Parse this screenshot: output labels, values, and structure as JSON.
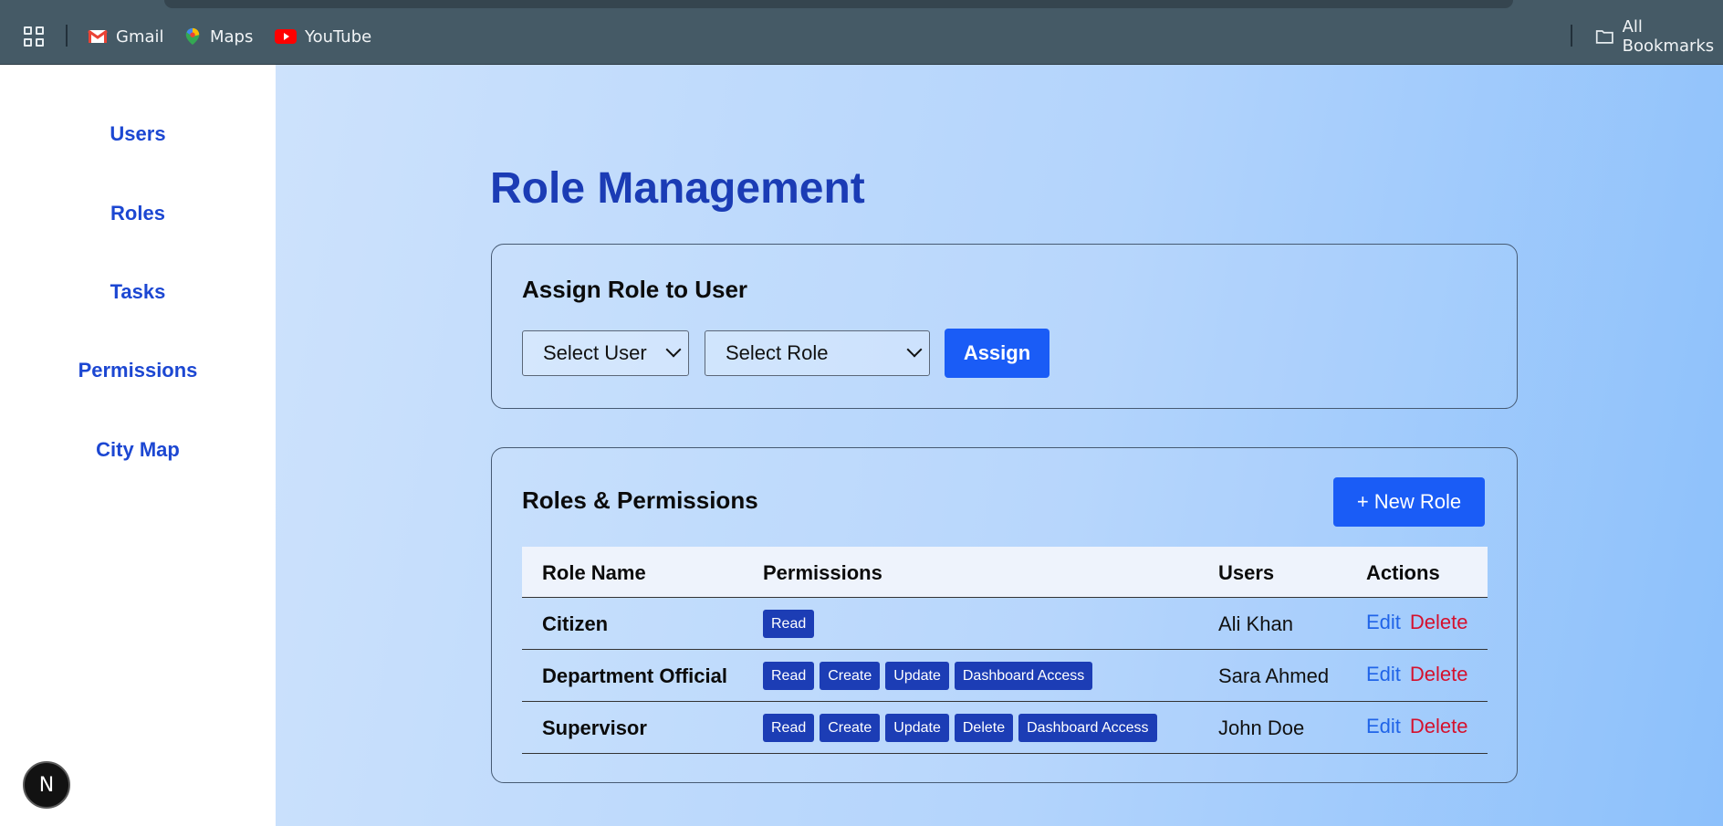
{
  "bookmarks": {
    "apps_icon": "apps-grid-icon",
    "items": [
      {
        "label": "Gmail",
        "icon": "gmail-icon"
      },
      {
        "label": "Maps",
        "icon": "maps-icon"
      },
      {
        "label": "YouTube",
        "icon": "youtube-icon"
      }
    ],
    "all_bookmarks": {
      "label": "All Bookmarks",
      "icon": "folder-icon"
    }
  },
  "sidebar": {
    "items": [
      {
        "label": "Users"
      },
      {
        "label": "Roles"
      },
      {
        "label": "Tasks"
      },
      {
        "label": "Permissions"
      },
      {
        "label": "City Map"
      }
    ],
    "badge": "N"
  },
  "page": {
    "title": "Role Management"
  },
  "assign": {
    "title": "Assign Role to User",
    "user_select": "Select User",
    "role_select": "Select Role",
    "button": "Assign"
  },
  "roles": {
    "title": "Roles & Permissions",
    "new_button": "+ New Role",
    "columns": [
      "Role Name",
      "Permissions",
      "Users",
      "Actions"
    ],
    "rows": [
      {
        "name": "Citizen",
        "permissions": [
          "Read"
        ],
        "user": "Ali Khan",
        "edit": "Edit",
        "delete": "Delete"
      },
      {
        "name": "Department Official",
        "permissions": [
          "Read",
          "Create",
          "Update",
          "Dashboard Access"
        ],
        "user": "Sara Ahmed",
        "edit": "Edit",
        "delete": "Delete"
      },
      {
        "name": "Supervisor",
        "permissions": [
          "Read",
          "Create",
          "Update",
          "Delete",
          "Dashboard Access"
        ],
        "user": "John Doe",
        "edit": "Edit",
        "delete": "Delete"
      }
    ]
  },
  "colors": {
    "accent": "#1a5cf6",
    "title": "#1b3cb5",
    "nav": "#1c47d2",
    "badge": "#1c3db5",
    "edit": "#2064e8",
    "delete": "#d5102d"
  }
}
